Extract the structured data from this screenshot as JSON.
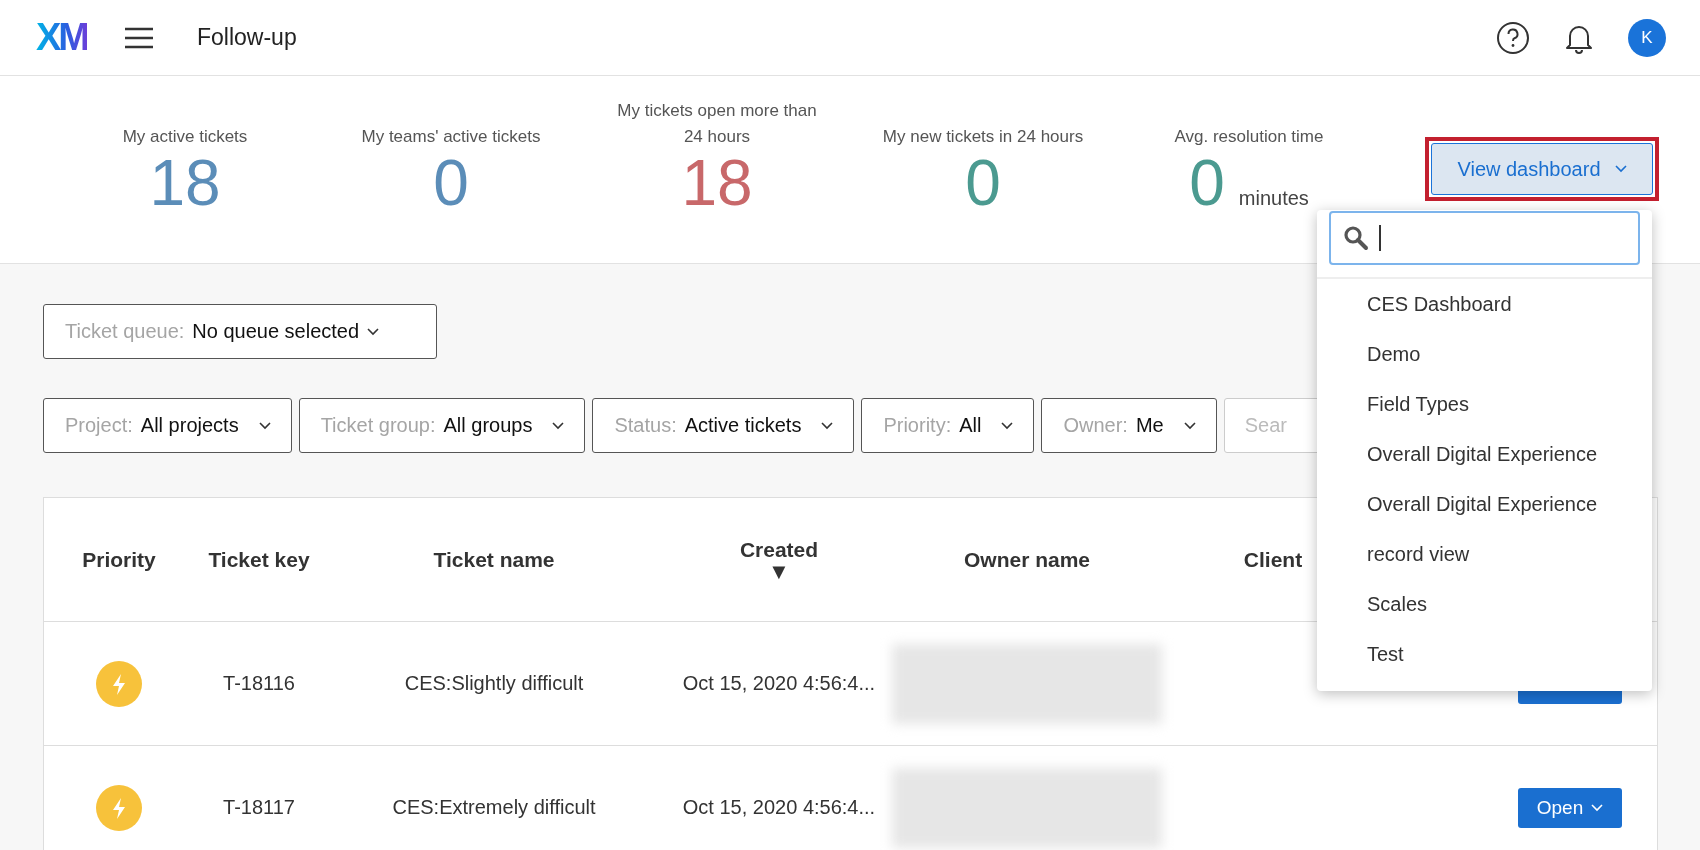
{
  "header": {
    "logo": "XM",
    "title": "Follow-up",
    "avatar": "K"
  },
  "stats": [
    {
      "label": "My active tickets",
      "value": "18",
      "color": "#5b8db8"
    },
    {
      "label": "My teams' active tickets",
      "value": "0",
      "color": "#5b8db8"
    },
    {
      "label": "My tickets open more than 24 hours",
      "value": "18",
      "color": "#c8686a"
    },
    {
      "label": "My new tickets in 24 hours",
      "value": "0",
      "color": "#4b9a90"
    },
    {
      "label": "Avg. resolution time",
      "value": "0",
      "unit": "minutes",
      "color": "#4b9a90"
    }
  ],
  "view_dashboard": {
    "label": "View dashboard",
    "expanded": true
  },
  "dashboard_menu": {
    "items": [
      "CES Dashboard",
      "Demo",
      "Field Types",
      "Overall Digital Experience",
      "Overall Digital Experience",
      "record view",
      "Scales",
      "Test"
    ]
  },
  "ticket_queue": {
    "label": "Ticket queue:",
    "value": "No queue selected"
  },
  "filters": [
    {
      "label": "Project:",
      "value": "All projects"
    },
    {
      "label": "Ticket group:",
      "value": "All groups"
    },
    {
      "label": "Status:",
      "value": "Active tickets"
    },
    {
      "label": "Priority:",
      "value": "All"
    },
    {
      "label": "Owner:",
      "value": "Me"
    }
  ],
  "search": {
    "placeholder": "Sear"
  },
  "table": {
    "columns": [
      {
        "label": "Priority"
      },
      {
        "label": "Ticket key"
      },
      {
        "label": "Ticket name"
      },
      {
        "label": "Created",
        "sort_mark": "▼"
      },
      {
        "label": "Owner name"
      },
      {
        "label": "Client"
      }
    ],
    "rows": [
      {
        "key": "T-18116",
        "name": "CES:Slightly difficult",
        "created": "Oct 15, 2020 4:56:4..."
      },
      {
        "key": "T-18117",
        "name": "CES:Extremely difficult",
        "created": "Oct 15, 2020 4:56:4...",
        "action": "Open"
      }
    ]
  }
}
